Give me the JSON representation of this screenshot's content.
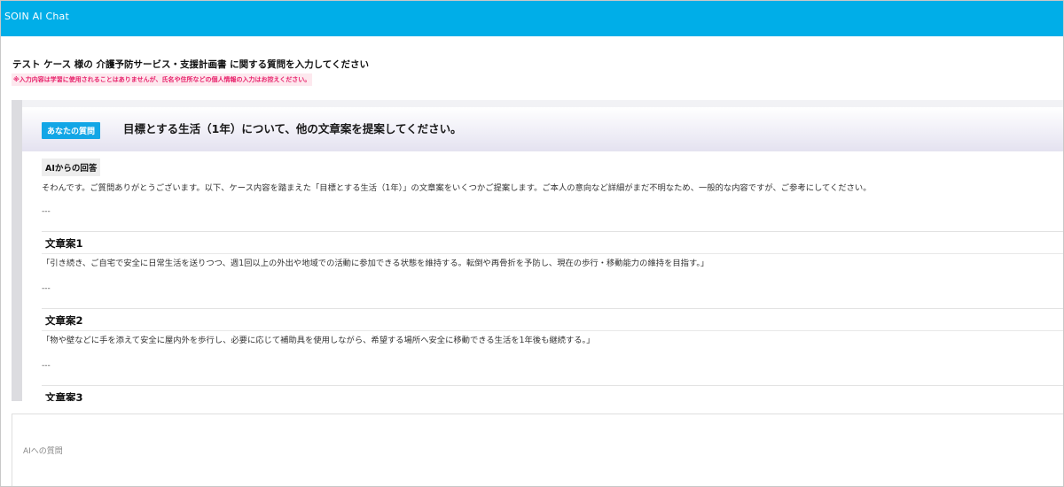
{
  "app": {
    "title": "SOIN AI Chat",
    "header_color": "#00aee8"
  },
  "prompt": {
    "heading": "テスト ケース 様の 介護予防サービス・支援計画書 に関する質問を入力してください",
    "notice": "※入力内容は学習に使用されることはありませんが、氏名や住所などの個人情報の入力はお控えください。",
    "notice_color": "#e8206a"
  },
  "question": {
    "badge": "あなたの質問",
    "text": "目標とする生活（1年）について、他の文章案を提案してください。",
    "badge_color": "#12a6e6"
  },
  "answer": {
    "badge": "AIからの回答",
    "intro": "そわんです。ご質問ありがとうございます。以下、ケース内容を踏まえた「目標とする生活（1年）」の文章案をいくつかご提案します。ご本人の意向など詳細がまだ不明なため、一般的な内容ですが、ご参考にしてください。",
    "separator": "---",
    "proposals": [
      {
        "title": "文章案1",
        "text": "「引き続き、ご自宅で安全に日常生活を送りつつ、週1回以上の外出や地域での活動に参加できる状態を維持する。転倒や再骨折を予防し、現在の歩行・移動能力の維持を目指す。」"
      },
      {
        "title": "文章案2",
        "text": "「物や壁などに手を添えて安全に屋内外を歩行し、必要に応じて補助具を使用しながら、希望する場所へ安全に移動できる生活を1年後も継続する。」"
      },
      {
        "title": "文章案3",
        "text": ""
      }
    ]
  },
  "input": {
    "placeholder": "AIへの質問",
    "value": ""
  }
}
